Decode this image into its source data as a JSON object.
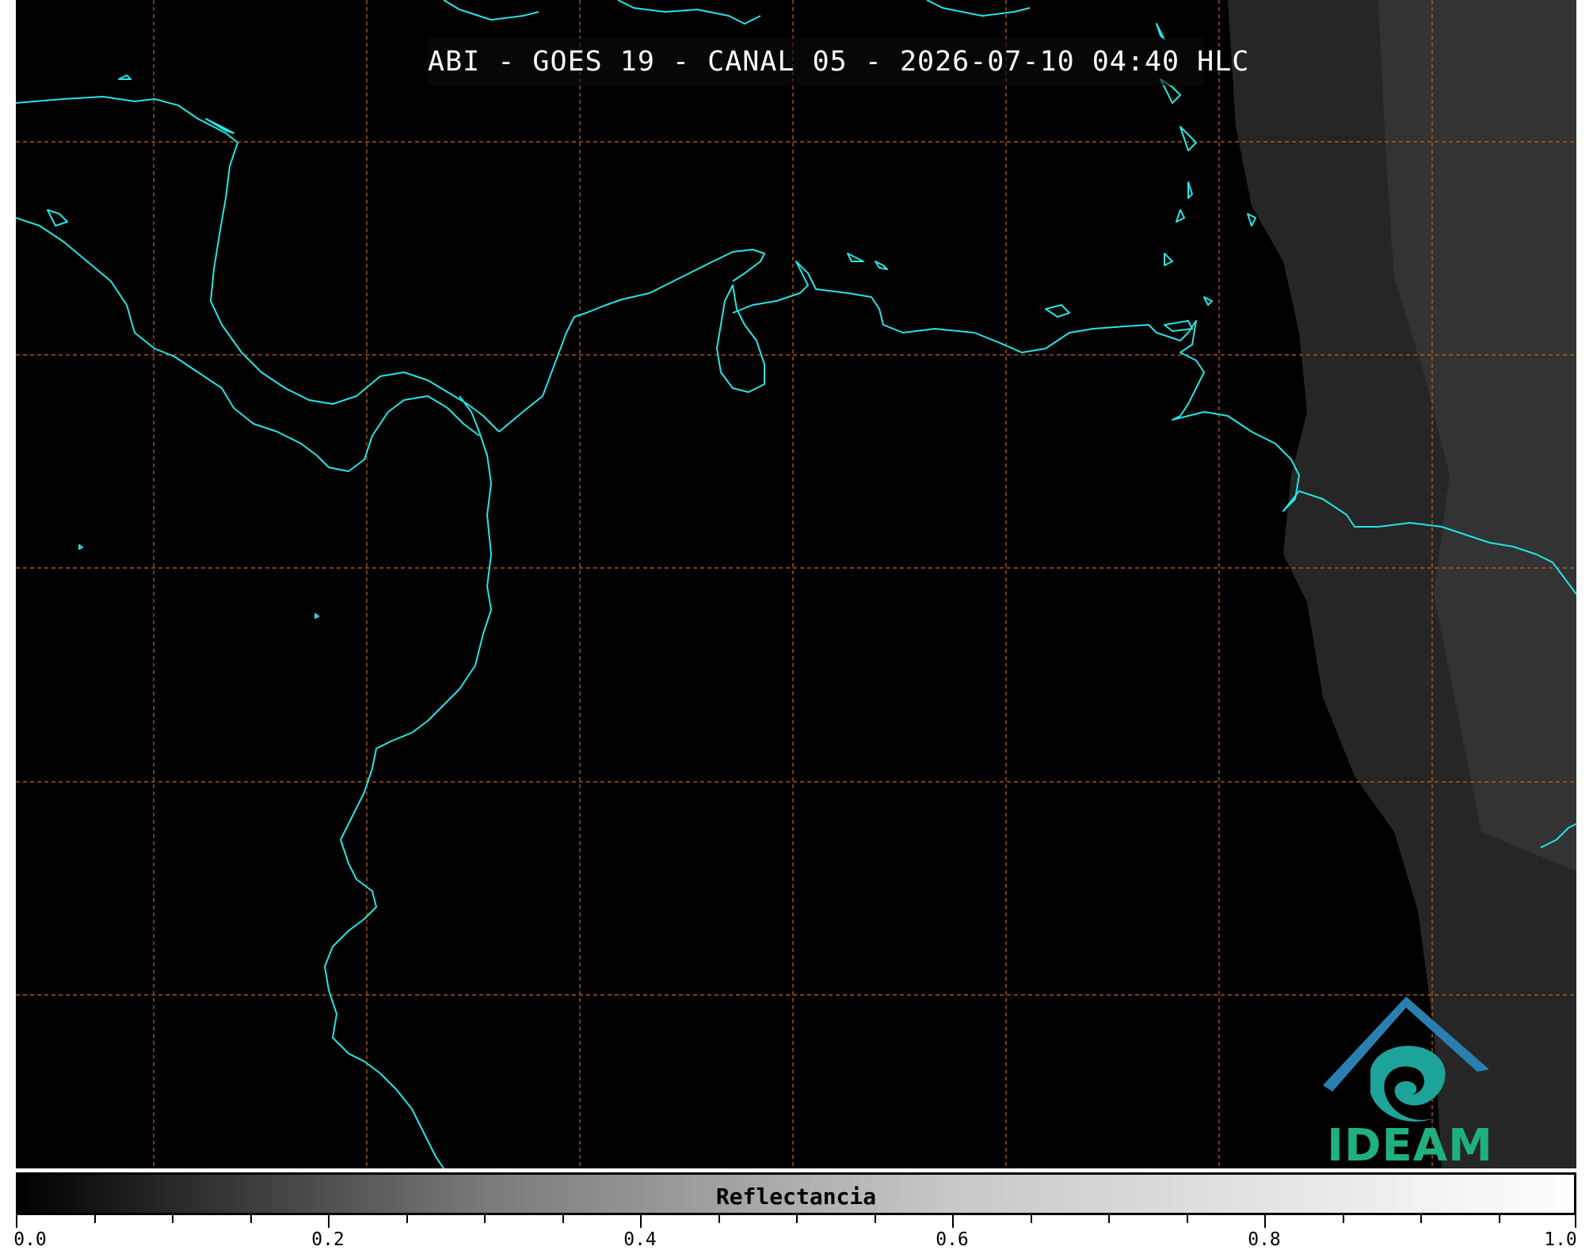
{
  "title": "ABI - GOES 19 - CANAL 05 - 2026-07-10 04:40 HLC",
  "colorbar": {
    "label": "Reflectancia",
    "ticks": [
      "0.0",
      "0.2",
      "0.4",
      "0.6",
      "0.8",
      "1.0"
    ]
  },
  "logo": {
    "text": "IDEAM"
  },
  "colors": {
    "coastline": "#22e6e6",
    "gridlines": "#c8651c",
    "background": "#000000",
    "logo": "#1fb07f"
  }
}
